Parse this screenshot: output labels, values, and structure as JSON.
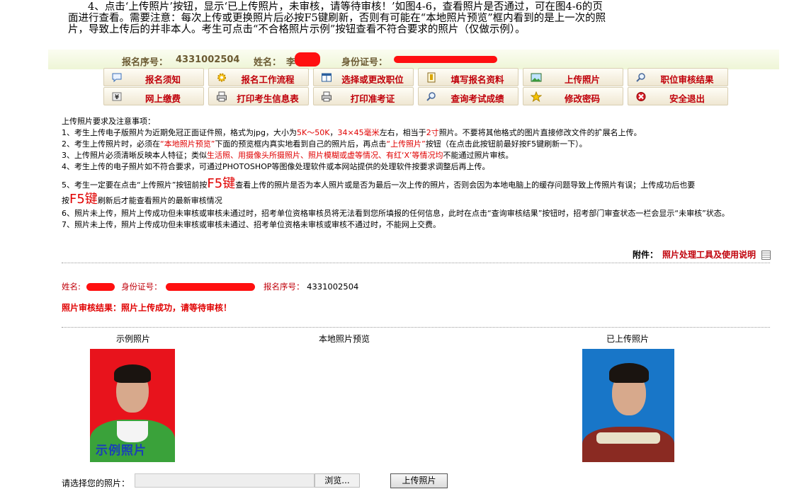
{
  "intro": {
    "line1": "4、点击‘上传照片’按钮，显示‘已上传照片，未审核，请等待审核！’如图4-6，查看照片是否通过，可在图4-6的页",
    "line2": "面进行查看。需要注意：每次上传或更换照片后必按F5键刷新，否则有可能在“本地照片预览”框内看到的是上一次的照",
    "line3": "片，导致上传后的并非本人。考生可点击“不合格照片示例”按钮查看不符合要求的照片（仅做示例）。"
  },
  "infobar": {
    "reg_label": "报名序号：",
    "reg_value": "4331002504",
    "name_label": "姓名：",
    "name_value": "李",
    "id_label": "身份证号："
  },
  "menu": {
    "row1": [
      {
        "label": "报名须知",
        "icon": "speech-bubble-icon"
      },
      {
        "label": "报名工作流程",
        "icon": "gear-icon"
      },
      {
        "label": "选择或更改职位",
        "icon": "window-icon"
      },
      {
        "label": "填写报名资料",
        "icon": "form-icon"
      },
      {
        "label": "上传照片",
        "icon": "picture-icon"
      },
      {
        "label": "职位审核结果",
        "icon": "magnifier-icon"
      }
    ],
    "row2": [
      {
        "label": "网上缴费",
        "icon": "yen-icon"
      },
      {
        "label": "打印考生信息表",
        "icon": "printer-icon"
      },
      {
        "label": "打印准考证",
        "icon": "printer-icon"
      },
      {
        "label": "查询考试成绩",
        "icon": "magnifier-icon"
      },
      {
        "label": "修改密码",
        "icon": "star-icon"
      },
      {
        "label": "安全退出",
        "icon": "exit-icon"
      }
    ]
  },
  "notes": {
    "title": "上传照片要求及注意事项：",
    "n1": {
      "a": "1、考生上传电子版照片为近期免冠正面证件照，格式为jpg，大小为",
      "size": "5K～50K",
      "sep": "，",
      "dim": "34×45毫米",
      "b": "左右，相当于",
      "inch": "2寸",
      "c": "照片。不要将其他格式的图片直接修改文件的扩展名上传。"
    },
    "n2": {
      "a": "2、考生上传照片时，必须在",
      "b": "“本地照片预览”",
      "c": "下面的预览框内真实地看到自己的照片后，再点击",
      "d": "“上传照片”",
      "e": "按钮（在点击此按钮前最好按F5键刷新一下）。"
    },
    "n3": {
      "a": "3、上传照片必须清晰反映本人特征；类似",
      "b": "生活照、用摄像头所摄照片、照片模糊或虚等情况、有红‘X’等情况均",
      "c": "不能通过照片审核。"
    },
    "n4": "4、考生上传的电子照片如不符合要求，可通过PHOTOSHOP等图像处理软件或本网站提供的处理软件按要求调整后再上传。",
    "n5": {
      "a": "5、考生一定要在点击“上传照片”按钮前按",
      "key": "F5键",
      "b": "查看上传的照片是否为本人照片或是否为最后一次上传的照片，否则会因为本地电脑上的缓存问题导致上传照片有误；上传成功后也要",
      "c": "按",
      "d": "刷新后才能查看照片的最新审核情况"
    },
    "n6": "6、照片未上传，照片上传成功但未审核或审核未通过时，招考单位资格审核员将无法看到您所填报的任何信息，此时在点击“查询审核结果”按钮时，招考部门审查状态一栏会显示“未审核”状态。",
    "n7": "7、照片未上传，照片上传成功但未审核或审核未通过、招考单位资格未审核或审核不通过时，不能网上交费。"
  },
  "attachment": {
    "label": "附件：",
    "link": "照片处理工具及使用说明"
  },
  "student": {
    "name_label": "姓名:",
    "id_label": "身份证号：",
    "reg_label": "报名序号：",
    "reg_value": "4331002504"
  },
  "result_text": "照片审核结果：照片上传成功，请等待审核！",
  "photos": {
    "sample_caption": "示例照片",
    "preview_caption": "本地照片预览",
    "uploaded_caption": "已上传照片",
    "sample_stamp": "示例照片"
  },
  "upload": {
    "choose_label": "请选择您的照片：",
    "browse_label": "浏览...",
    "upload_button": "上传照片"
  }
}
